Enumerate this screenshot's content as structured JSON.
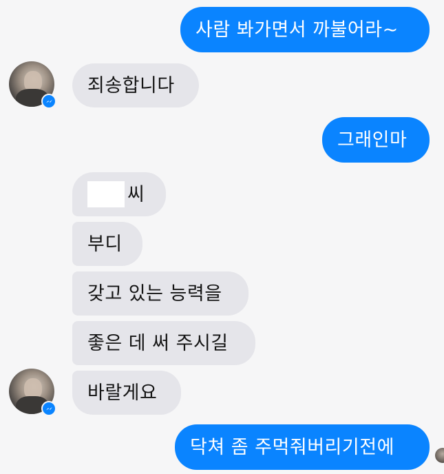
{
  "messages": {
    "m1": "사람 봐가면서 까불어라~",
    "m2": "죄송합니다",
    "m3": "그래인마",
    "m4_suffix": "씨",
    "m5": "부디",
    "m6": "갖고 있는 능력을",
    "m7": "좋은 데 써 주시길",
    "m8": "바랄게요",
    "m9": "닥쳐 좀 주먹줘버리기전에"
  },
  "colors": {
    "outgoing_bubble": "#0a84ff",
    "incoming_bubble": "#e5e5ea",
    "background": "#f6f6f7"
  },
  "icons": {
    "messenger_badge": "messenger-icon"
  }
}
